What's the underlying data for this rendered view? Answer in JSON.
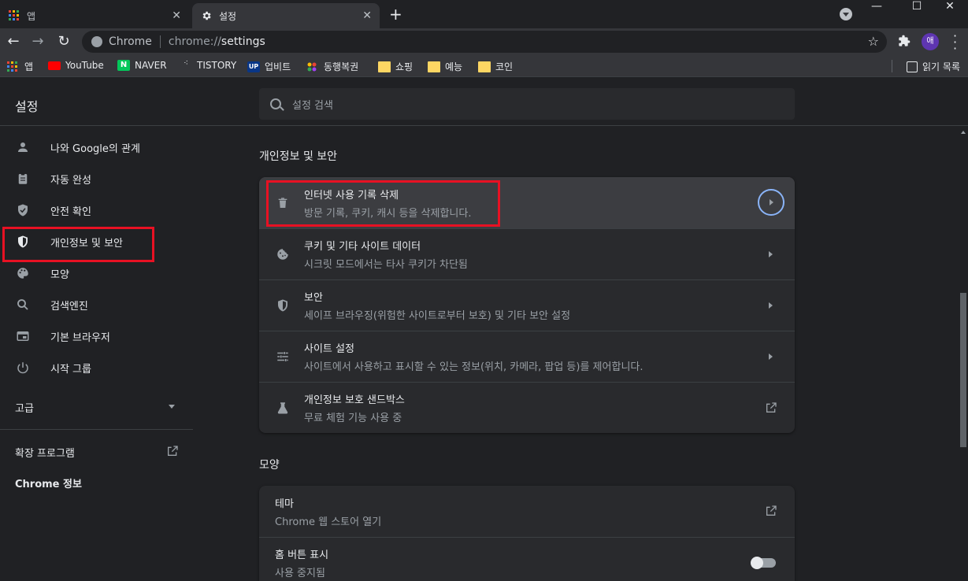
{
  "tabs": [
    {
      "label": "앱",
      "icon": "apps-grid-icon"
    },
    {
      "label": "설정",
      "icon": "gear-icon"
    }
  ],
  "omnibox": {
    "scheme_label": "Chrome",
    "url_prefix": "chrome://",
    "url_path": "settings"
  },
  "profile_initial": "애",
  "bookmarks": [
    {
      "label": "앱",
      "icon": "apps-grid-icon"
    },
    {
      "label": "YouTube",
      "icon": "youtube-icon"
    },
    {
      "label": "NAVER",
      "icon": "naver-icon"
    },
    {
      "label": "TISTORY",
      "icon": "tistory-icon"
    },
    {
      "label": "업비트",
      "icon": "upbit-icon"
    },
    {
      "label": "동행복권",
      "icon": "lottery-icon"
    },
    {
      "label": "쇼핑",
      "icon": "folder-icon"
    },
    {
      "label": "예능",
      "icon": "folder-icon"
    },
    {
      "label": "코인",
      "icon": "folder-icon"
    }
  ],
  "reading_list": "읽기 목록",
  "header": {
    "title": "설정",
    "search_placeholder": "설정 검색"
  },
  "sidebar": {
    "items": [
      {
        "label": "나와 Google의 관계",
        "icon": "person-icon"
      },
      {
        "label": "자동 완성",
        "icon": "clipboard-icon"
      },
      {
        "label": "안전 확인",
        "icon": "shield-check-icon"
      },
      {
        "label": "개인정보 및 보안",
        "icon": "shield-icon"
      },
      {
        "label": "모양",
        "icon": "palette-icon"
      },
      {
        "label": "검색엔진",
        "icon": "search-icon"
      },
      {
        "label": "기본 브라우저",
        "icon": "browser-icon"
      },
      {
        "label": "시작 그룹",
        "icon": "power-icon"
      }
    ],
    "advanced": "고급",
    "extensions": "확장 프로그램",
    "about": "Chrome 정보"
  },
  "privacy_section": {
    "title": "개인정보 및 보안",
    "rows": [
      {
        "title": "인터넷 사용 기록 삭제",
        "subtitle": "방문 기록, 쿠키, 캐시 등을 삭제합니다.",
        "icon": "trash-icon"
      },
      {
        "title": "쿠키 및 기타 사이트 데이터",
        "subtitle": "시크릿 모드에서는 타사 쿠키가 차단됨",
        "icon": "cookie-icon"
      },
      {
        "title": "보안",
        "subtitle": "세이프 브라우징(위험한 사이트로부터 보호) 및 기타 보안 설정",
        "icon": "shield-icon"
      },
      {
        "title": "사이트 설정",
        "subtitle": "사이트에서 사용하고 표시할 수 있는 정보(위치, 카메라, 팝업 등)를 제어합니다.",
        "icon": "sliders-icon"
      },
      {
        "title": "개인정보 보호 샌드박스",
        "subtitle": "무료 체험 기능 사용 중",
        "icon": "flask-icon"
      }
    ]
  },
  "appearance_section": {
    "title": "모양",
    "rows": [
      {
        "title": "테마",
        "subtitle": "Chrome 웹 스토어 열기"
      },
      {
        "title": "홈 버튼 표시",
        "subtitle": "사용 중지됨"
      }
    ]
  },
  "colors": {
    "highlight": "#e81123",
    "accent": "#8ab4f8",
    "profile": "#5e35b1"
  }
}
